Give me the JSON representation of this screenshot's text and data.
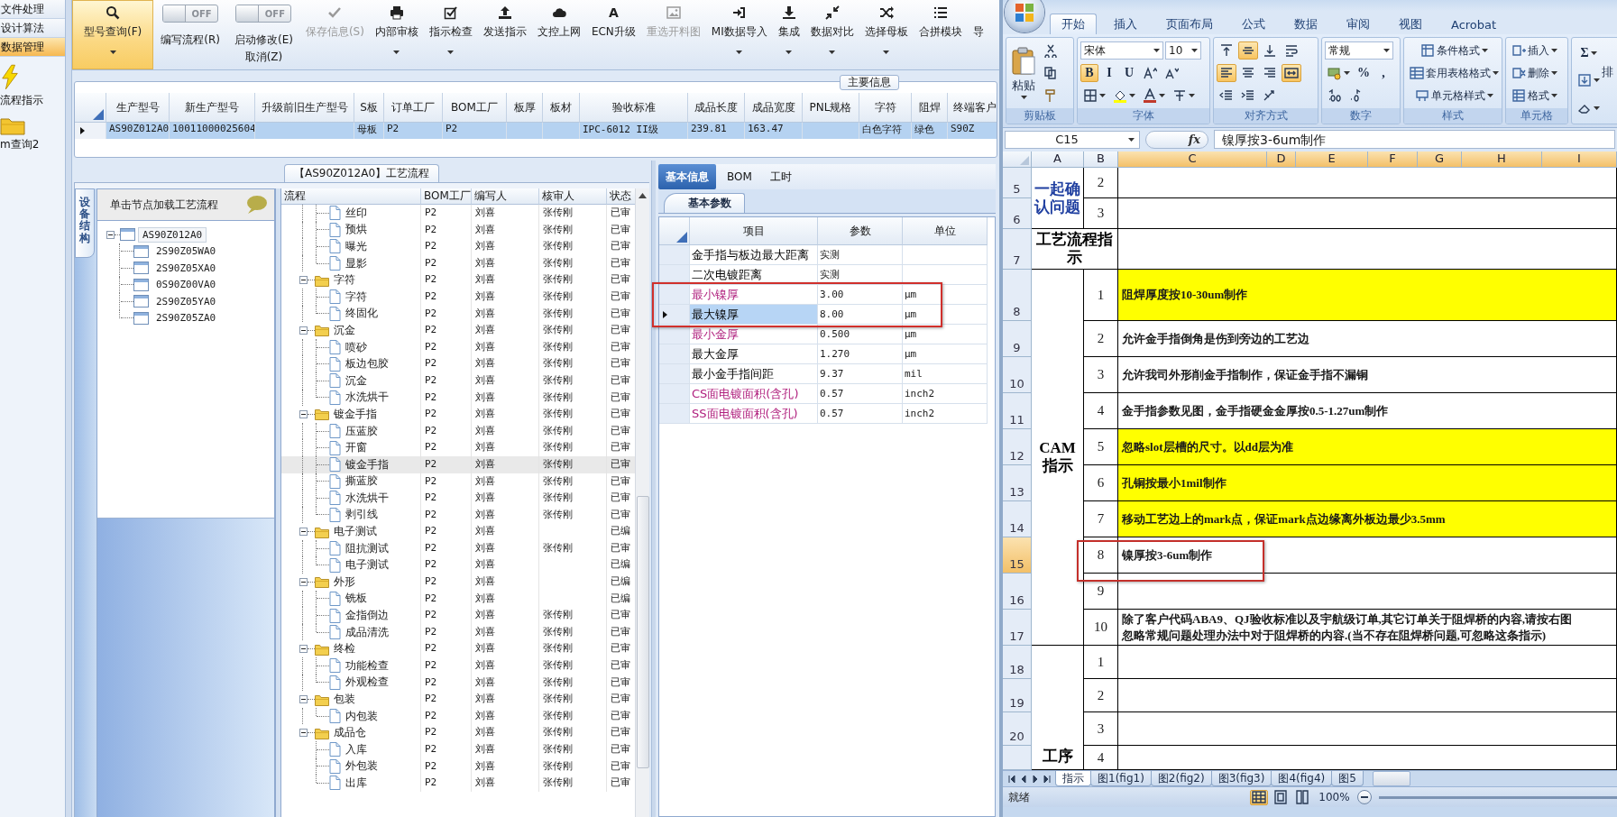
{
  "nav": {
    "items": [
      {
        "label": "文件处理",
        "selected": false
      },
      {
        "label": "设计算法",
        "selected": false
      },
      {
        "label": "数据管理",
        "selected": true
      }
    ],
    "shortcuts": [
      {
        "label": "流程指示",
        "kind": "lightning"
      },
      {
        "label": "m查询2",
        "kind": "folder"
      }
    ]
  },
  "toolbar": [
    {
      "kind": "button",
      "label": "型号查询(F)",
      "selected": true,
      "disabled": false,
      "dropdown": true
    },
    {
      "kind": "toggle",
      "switch_text": "OFF",
      "on": false,
      "label": "编写流程(R)"
    },
    {
      "kind": "toggle",
      "switch_text": "OFF",
      "on": false,
      "label": "启动修改(E)",
      "sublabel": "取消(Z)"
    },
    {
      "kind": "button",
      "label": "保存信息(S)",
      "selected": false,
      "disabled": true,
      "dropdown": false
    },
    {
      "kind": "button",
      "label": "内部审核",
      "selected": false,
      "disabled": false,
      "dropdown": true
    },
    {
      "kind": "button",
      "label": "指示检查",
      "selected": false,
      "disabled": false,
      "dropdown": true
    },
    {
      "kind": "button",
      "label": "发送指示",
      "selected": false,
      "disabled": false,
      "dropdown": false
    },
    {
      "kind": "button",
      "label": "文控上网",
      "selected": false,
      "disabled": false,
      "dropdown": false
    },
    {
      "kind": "button",
      "glyph": "A",
      "label": "ECN升级",
      "selected": false,
      "disabled": false,
      "dropdown": false
    },
    {
      "kind": "button",
      "label": "重选开料图",
      "selected": false,
      "disabled": true,
      "dropdown": false
    },
    {
      "kind": "button",
      "label": "MI数据导入",
      "selected": false,
      "disabled": false,
      "dropdown": true
    },
    {
      "kind": "button",
      "label": "集成",
      "selected": false,
      "disabled": false,
      "dropdown": true
    },
    {
      "kind": "button",
      "label": "数据对比",
      "selected": false,
      "disabled": false,
      "dropdown": true
    },
    {
      "kind": "button",
      "label": "选择母板",
      "selected": false,
      "disabled": false,
      "dropdown": true
    },
    {
      "kind": "button",
      "label": "合拼模块",
      "selected": false,
      "disabled": false,
      "dropdown": false
    },
    {
      "kind": "button",
      "label": "导",
      "selected": false,
      "disabled": false,
      "dropdown": false
    }
  ],
  "main_info": {
    "title": "主要信息",
    "columns": [
      "生产型号",
      "新生产型号",
      "升级前旧生产型号",
      "S板",
      "订单工厂",
      "BOM工厂",
      "板厚",
      "板材",
      "验收标准",
      "成品长度",
      "成品宽度",
      "PNL规格",
      "字符",
      "阻焊",
      "终端客户"
    ],
    "rows": [
      {
        "selected": true,
        "cells": [
          "AS90Z012A0",
          "10011000025604",
          null,
          "母板",
          "P2",
          "P2",
          null,
          null,
          "IPC-6012 II级",
          "239.81",
          "163.47",
          null,
          "白色字符",
          "绿色",
          "S90Z"
        ]
      }
    ]
  },
  "process_flow": {
    "title": "【AS90Z012A0】工艺流程",
    "side_tab": {
      "label": "设备结构",
      "selected": true
    },
    "tree_header": "单击节点加载工艺流程",
    "equipment_tree": [
      {
        "label": "AS90Z012A0",
        "selected": true,
        "expanded": true,
        "children": [
          {
            "label": "2S90Z05WA0",
            "selected": false
          },
          {
            "label": "2S90Z05XA0",
            "selected": false
          },
          {
            "label": "0S90Z00VA0",
            "selected": false
          },
          {
            "label": "2S90Z05YA0",
            "selected": false
          },
          {
            "label": "2S90Z05ZA0",
            "selected": false
          }
        ]
      }
    ],
    "columns": [
      "流程",
      "BOM工厂",
      "编写人",
      "核审人",
      "状态"
    ],
    "rows": [
      {
        "children": [
          {
            "name": "丝印",
            "bom": "P2",
            "writer": "刘喜",
            "reviewer": "张传刚",
            "status": "已审",
            "selected": false
          },
          {
            "name": "预烘",
            "bom": "P2",
            "writer": "刘喜",
            "reviewer": "张传刚",
            "status": "已审",
            "selected": false
          },
          {
            "name": "曝光",
            "bom": "P2",
            "writer": "刘喜",
            "reviewer": "张传刚",
            "status": "已审",
            "selected": false
          },
          {
            "name": "显影",
            "bom": "P2",
            "writer": "刘喜",
            "reviewer": "张传刚",
            "status": "已审",
            "selected": false
          }
        ]
      },
      {
        "name": "字符",
        "bom": "P2",
        "writer": "刘喜",
        "reviewer": "张传刚",
        "status": "已审",
        "selected": false,
        "expanded": true,
        "children": [
          {
            "name": "字符",
            "bom": "P2",
            "writer": "刘喜",
            "reviewer": "张传刚",
            "status": "已审",
            "selected": false
          },
          {
            "name": "终固化",
            "bom": "P2",
            "writer": "刘喜",
            "reviewer": "张传刚",
            "status": "已审",
            "selected": false
          }
        ]
      },
      {
        "name": "沉金",
        "bom": "P2",
        "writer": "刘喜",
        "reviewer": "张传刚",
        "status": "已审",
        "selected": false,
        "expanded": true,
        "children": [
          {
            "name": "喷砂",
            "bom": "P2",
            "writer": "刘喜",
            "reviewer": "张传刚",
            "status": "已审",
            "selected": false
          },
          {
            "name": "板边包胶",
            "bom": "P2",
            "writer": "刘喜",
            "reviewer": "张传刚",
            "status": "已审",
            "selected": false
          },
          {
            "name": "沉金",
            "bom": "P2",
            "writer": "刘喜",
            "reviewer": "张传刚",
            "status": "已审",
            "selected": false
          },
          {
            "name": "水洗烘干",
            "bom": "P2",
            "writer": "刘喜",
            "reviewer": "张传刚",
            "status": "已审",
            "selected": false
          }
        ]
      },
      {
        "name": "镀金手指",
        "bom": "P2",
        "writer": "刘喜",
        "reviewer": "张传刚",
        "status": "已审",
        "selected": false,
        "expanded": true,
        "children": [
          {
            "name": "压蓝胶",
            "bom": "P2",
            "writer": "刘喜",
            "reviewer": "张传刚",
            "status": "已审",
            "selected": false
          },
          {
            "name": "开窗",
            "bom": "P2",
            "writer": "刘喜",
            "reviewer": "张传刚",
            "status": "已审",
            "selected": false
          },
          {
            "name": "镀金手指",
            "bom": "P2",
            "writer": "刘喜",
            "reviewer": "张传刚",
            "status": "已审",
            "selected": true
          },
          {
            "name": "撕蓝胶",
            "bom": "P2",
            "writer": "刘喜",
            "reviewer": "张传刚",
            "status": "已审",
            "selected": false
          },
          {
            "name": "水洗烘干",
            "bom": "P2",
            "writer": "刘喜",
            "reviewer": "张传刚",
            "status": "已审",
            "selected": false
          },
          {
            "name": "剥引线",
            "bom": "P2",
            "writer": "刘喜",
            "reviewer": "张传刚",
            "status": "已审",
            "selected": false
          }
        ]
      },
      {
        "name": "电子测试",
        "bom": "P2",
        "writer": "刘喜",
        "status": "已编",
        "selected": false,
        "expanded": true,
        "children": [
          {
            "name": "阻抗测试",
            "bom": "P2",
            "writer": "刘喜",
            "reviewer": "张传刚",
            "status": "已审",
            "selected": false
          },
          {
            "name": "电子测试",
            "bom": "P2",
            "writer": "刘喜",
            "status": "已编",
            "selected": false
          }
        ]
      },
      {
        "name": "外形",
        "bom": "P2",
        "writer": "刘喜",
        "status": "已编",
        "selected": false,
        "expanded": true,
        "children": [
          {
            "name": "铣板",
            "bom": "P2",
            "writer": "刘喜",
            "status": "已编",
            "selected": false
          },
          {
            "name": "金指倒边",
            "bom": "P2",
            "writer": "刘喜",
            "reviewer": "张传刚",
            "status": "已审",
            "selected": false
          },
          {
            "name": "成品清洗",
            "bom": "P2",
            "writer": "刘喜",
            "reviewer": "张传刚",
            "status": "已审",
            "selected": false
          }
        ]
      },
      {
        "name": "终检",
        "bom": "P2",
        "writer": "刘喜",
        "reviewer": "张传刚",
        "status": "已审",
        "selected": false,
        "expanded": true,
        "children": [
          {
            "name": "功能检查",
            "bom": "P2",
            "writer": "刘喜",
            "reviewer": "张传刚",
            "status": "已审",
            "selected": false
          },
          {
            "name": "外观检查",
            "bom": "P2",
            "writer": "刘喜",
            "reviewer": "张传刚",
            "status": "已审",
            "selected": false
          }
        ]
      },
      {
        "name": "包装",
        "bom": "P2",
        "writer": "刘喜",
        "reviewer": "张传刚",
        "status": "已审",
        "selected": false,
        "expanded": true,
        "children": [
          {
            "name": "内包装",
            "bom": "P2",
            "writer": "刘喜",
            "reviewer": "张传刚",
            "status": "已审",
            "selected": false
          }
        ]
      },
      {
        "name": "成品仓",
        "bom": "P2",
        "writer": "刘喜",
        "reviewer": "张传刚",
        "status": "已审",
        "selected": false,
        "expanded": true,
        "children": [
          {
            "name": "入库",
            "bom": "P2",
            "writer": "刘喜",
            "reviewer": "张传刚",
            "status": "已审",
            "selected": false
          },
          {
            "name": "外包装",
            "bom": "P2",
            "writer": "刘喜",
            "reviewer": "张传刚",
            "status": "已审",
            "selected": false
          },
          {
            "name": "出库",
            "bom": "P2",
            "writer": "刘喜",
            "reviewer": "张传刚",
            "status": "已审",
            "selected": false
          }
        ]
      }
    ]
  },
  "params": {
    "tabs": [
      {
        "label": "基本信息",
        "selected": true
      },
      {
        "label": "BOM",
        "selected": false
      },
      {
        "label": "工时",
        "selected": false
      }
    ],
    "subtab": {
      "label": "基本参数",
      "selected": true
    },
    "columns": [
      "项目",
      "参数",
      "单位"
    ],
    "rows": [
      {
        "item": "金手指与板边最大距离",
        "value": "实测",
        "emphasized": false,
        "selected": false,
        "marked": false
      },
      {
        "item": "二次电镀距离",
        "value": "实测",
        "emphasized": false,
        "selected": false,
        "marked": false
      },
      {
        "item": "最小镍厚",
        "value": "3.00",
        "unit": "μm",
        "emphasized": true,
        "selected": false,
        "marked": true
      },
      {
        "item": "最大镍厚",
        "value": "8.00",
        "unit": "μm",
        "emphasized": false,
        "selected": true,
        "marked": true
      },
      {
        "item": "最小金厚",
        "value": "0.500",
        "unit": "μm",
        "emphasized": true,
        "selected": false,
        "marked": false
      },
      {
        "item": "最大金厚",
        "value": "1.270",
        "unit": "μm",
        "emphasized": false,
        "selected": false,
        "marked": false
      },
      {
        "item": "最小金手指间距",
        "value": "9.37",
        "unit": "mil",
        "emphasized": false,
        "selected": false,
        "marked": false
      },
      {
        "item": "CS面电镀面积(含孔)",
        "value": "0.57",
        "unit": "inch2",
        "emphasized": true,
        "selected": false,
        "marked": false
      },
      {
        "item": "SS面电镀面积(含孔)",
        "value": "0.57",
        "unit": "inch2",
        "emphasized": true,
        "selected": false,
        "marked": false
      }
    ]
  },
  "excel": {
    "ribbon_tabs": [
      {
        "label": "开始",
        "selected": true
      },
      {
        "label": "插入",
        "selected": false
      },
      {
        "label": "页面布局",
        "selected": false
      },
      {
        "label": "公式",
        "selected": false
      },
      {
        "label": "数据",
        "selected": false
      },
      {
        "label": "审阅",
        "selected": false
      },
      {
        "label": "视图",
        "selected": false
      },
      {
        "label": "Acrobat",
        "selected": false
      }
    ],
    "clipboard": {
      "paste": "粘贴",
      "label": "剪贴板"
    },
    "font": {
      "name": "宋体",
      "size": "10",
      "styles": [
        {
          "glyph": "B",
          "selected": true
        },
        {
          "glyph": "I",
          "selected": false
        },
        {
          "glyph": "U",
          "selected": false
        }
      ],
      "label": "字体"
    },
    "alignment": {
      "buttons": [
        {
          "selected": false
        },
        {
          "selected": true
        },
        {
          "selected": false
        },
        {
          "selected": false
        },
        {
          "selected": true
        },
        {
          "selected": false
        },
        {
          "selected": false
        },
        {
          "selected": true
        },
        {
          "selected": false
        },
        {
          "selected": false
        },
        {
          "selected": false
        }
      ],
      "label": "对齐方式"
    },
    "number": {
      "format": "常规",
      "symbols": [
        "%",
        ","
      ],
      "label": "数字"
    },
    "styles": {
      "items": [
        "条件格式",
        "套用表格格式",
        "单元格样式"
      ],
      "label": "样式"
    },
    "cells": {
      "items": [
        "插入",
        "删除",
        "格式"
      ],
      "label": "单元格"
    },
    "editing": {
      "glyph": "Σ",
      "items": [
        "排"
      ]
    },
    "name_box": "C15",
    "fx_label": "fx",
    "formula": "镍厚按3-6um制作",
    "columns": [
      {
        "label": "A",
        "selected": false
      },
      {
        "label": "B",
        "selected": false
      },
      {
        "label": "C",
        "selected": true
      },
      {
        "label": "D",
        "selected": true
      },
      {
        "label": "E",
        "selected": true
      },
      {
        "label": "F",
        "selected": true
      },
      {
        "label": "G",
        "selected": true
      },
      {
        "label": "H",
        "selected": true
      },
      {
        "label": "I",
        "selected": true
      }
    ],
    "row_numbers": [
      {
        "label": "5",
        "selected": false
      },
      {
        "label": "6",
        "selected": false
      },
      {
        "label": "7",
        "selected": false
      },
      {
        "label": "8",
        "selected": false
      },
      {
        "label": "9",
        "selected": false
      },
      {
        "label": "10",
        "selected": false
      },
      {
        "label": "11",
        "selected": false
      },
      {
        "label": "12",
        "selected": false
      },
      {
        "label": "13",
        "selected": false
      },
      {
        "label": "14",
        "selected": false
      },
      {
        "label": "15",
        "selected": true
      },
      {
        "label": "16",
        "selected": false
      },
      {
        "label": "17",
        "selected": false
      },
      {
        "label": "18",
        "selected": false
      },
      {
        "label": "19",
        "selected": false
      },
      {
        "label": "20",
        "selected": false
      }
    ],
    "sections": [
      {
        "kind": "numbered",
        "label": "一起确认问题",
        "color": "#1f3fa0",
        "items": [
          {
            "number": "2",
            "highlighted": false,
            "marked": false
          },
          {
            "number": "3",
            "highlighted": false,
            "marked": false
          }
        ]
      },
      {
        "kind": "heading",
        "label": "工艺流程指示",
        "color": "#000000"
      },
      {
        "kind": "numbered",
        "label": "CAM指示",
        "color": "#000000",
        "items": [
          {
            "number": "1",
            "text": "阻焊厚度按10-30um制作",
            "highlighted": true,
            "marked": false
          },
          {
            "number": "2",
            "text": "允许金手指倒角是伤到旁边的工艺边",
            "highlighted": false,
            "marked": false
          },
          {
            "number": "3",
            "text": "允许我司外形削金手指制作，保证金手指不漏铜",
            "highlighted": false,
            "marked": false
          },
          {
            "number": "4",
            "text": "金手指参数见图，金手指硬金金厚按0.5-1.27um制作",
            "highlighted": false,
            "marked": false
          },
          {
            "number": "5",
            "text": "忽略slot层槽的尺寸。以dd层为准",
            "highlighted": true,
            "marked": false
          },
          {
            "number": "6",
            "text": "孔铜按最小1mil制作",
            "highlighted": true,
            "marked": false
          },
          {
            "number": "7",
            "text": "移动工艺边上的mark点，保证mark点边缘离外板边最少3.5mm",
            "highlighted": true,
            "marked": false
          },
          {
            "number": "8",
            "text": "镍厚按3-6um制作",
            "highlighted": false,
            "marked": true
          },
          {
            "number": "9",
            "highlighted": false,
            "marked": false
          },
          {
            "number": "10",
            "lines": [
              "除了客户代码ABA9、QJ验收标准以及宇航级订单,其它订单关于阻焊桥的内容,请按右图",
              "忽略常规问题处理办法中对于阻焊桥的内容.(当不存在阻焊桥问题,可忽略这条指示)"
            ],
            "highlighted": false,
            "marked": false
          }
        ]
      },
      {
        "kind": "numbered",
        "label": "工序",
        "color": "#000000",
        "items": [
          {
            "number": "1",
            "highlighted": false,
            "marked": false
          },
          {
            "number": "2",
            "highlighted": false,
            "marked": false
          },
          {
            "number": "3",
            "highlighted": false,
            "marked": false
          },
          {
            "number": "4",
            "highlighted": false,
            "marked": false
          }
        ]
      }
    ],
    "sheet_tabs": [
      {
        "label": "指示",
        "selected": true
      },
      {
        "label": "图1(fig1)",
        "selected": false
      },
      {
        "label": "图2(fig2)",
        "selected": false
      },
      {
        "label": "图3(fig3)",
        "selected": false
      },
      {
        "label": "图4(fig4)",
        "selected": false
      },
      {
        "label": "图5",
        "selected": false
      }
    ],
    "status": "就绪",
    "views": [
      {
        "selected": true
      },
      {
        "selected": false
      },
      {
        "selected": false
      }
    ],
    "zoom": "100%"
  }
}
